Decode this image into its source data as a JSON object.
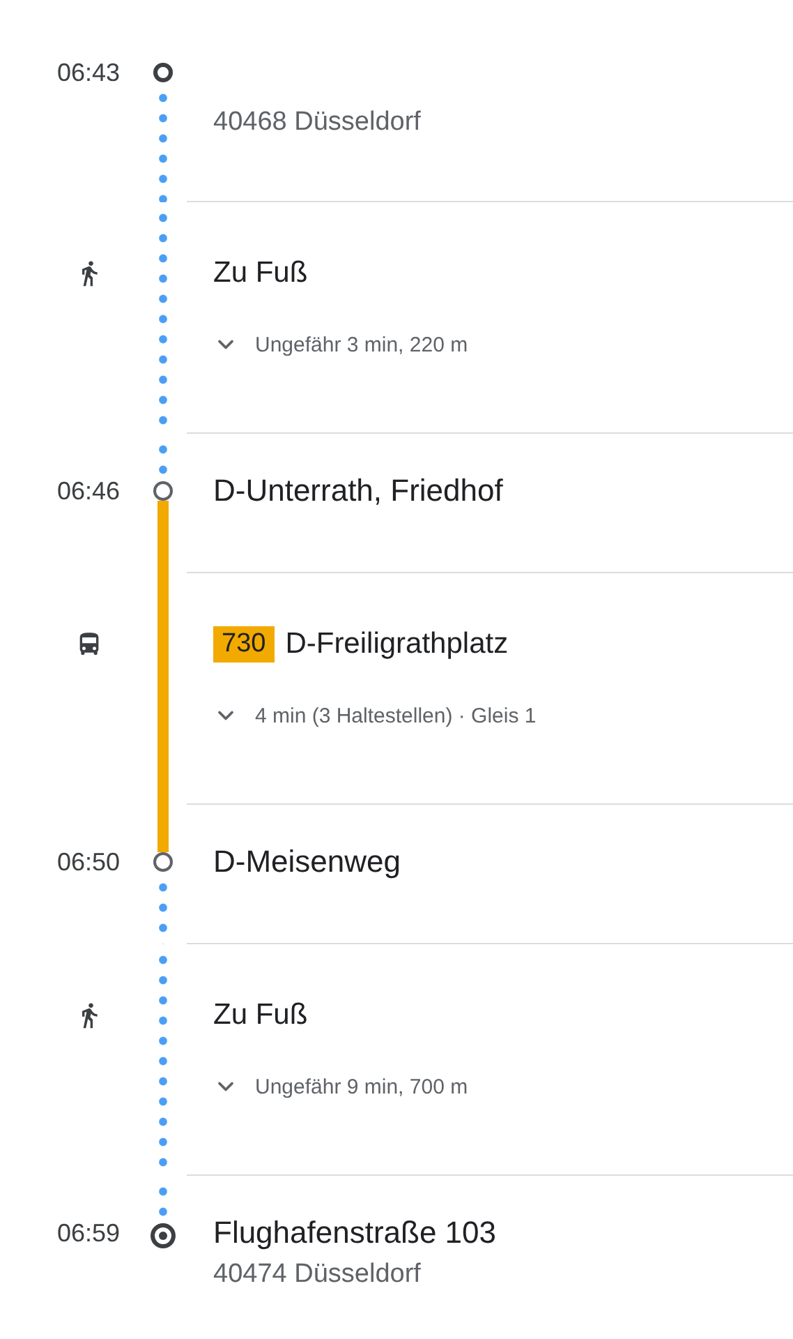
{
  "itinerary": [
    {
      "kind": "origin",
      "time": "06:43",
      "address": "40468 Düsseldorf"
    },
    {
      "kind": "walk",
      "title": "Zu Fuß",
      "detail": "Ungefähr 3 min, 220 m",
      "expanded": false
    },
    {
      "kind": "stop",
      "time": "06:46",
      "name": "D-Unterrath, Friedhof"
    },
    {
      "kind": "bus",
      "line": "730",
      "color": "#f2a900",
      "title": "D-Freiligrathplatz",
      "detail": "4 min (3 Haltestellen) · Gleis 1",
      "expanded": false
    },
    {
      "kind": "stop",
      "time": "06:50",
      "name": "D-Meisenweg"
    },
    {
      "kind": "walk",
      "title": "Zu Fuß",
      "detail": "Ungefähr 9 min, 700 m",
      "expanded": false
    },
    {
      "kind": "destination",
      "time": "06:59",
      "name": "Flughafenstraße 103",
      "address": "40474 Düsseldorf"
    }
  ]
}
